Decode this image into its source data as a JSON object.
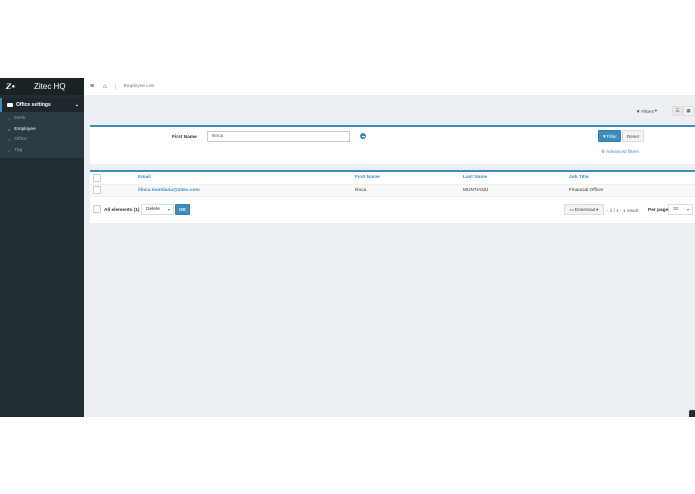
{
  "sidebar": {
    "brand": "Zitec HQ",
    "group_label": "Office settings",
    "items": [
      {
        "label": "Desk",
        "active": false
      },
      {
        "label": "Employee",
        "active": true
      },
      {
        "label": "Office",
        "active": false
      },
      {
        "label": "Tag",
        "active": false
      }
    ]
  },
  "topbar": {
    "breadcrumb": "Employee List"
  },
  "actions": {
    "filters_label": "Filters"
  },
  "filter": {
    "field_label": "First Name",
    "value": "Ilinca",
    "submit_label": "Filter",
    "reset_label": "Reset",
    "advanced_label": "Advanced filters"
  },
  "table": {
    "columns": [
      "Email",
      "First Name",
      "Last Name",
      "Job Title"
    ],
    "rows": [
      {
        "email": "ilinca.muntianu@zitec.com",
        "first_name": "Ilinca",
        "last_name": "MUNTIANU",
        "job_title": "Financial Officer"
      }
    ]
  },
  "footer": {
    "all_elements": "All elements (1)",
    "batch_action": "Delete",
    "ok_label": "OK",
    "download_label": "Download",
    "pager": "- 1 / 1 - 1 result -",
    "per_page_label": "Per page",
    "per_page_value": "32"
  },
  "colors": {
    "accent": "#3c8dbc",
    "sidebar_bg": "#222d32",
    "content_bg": "#ecf0f5"
  }
}
